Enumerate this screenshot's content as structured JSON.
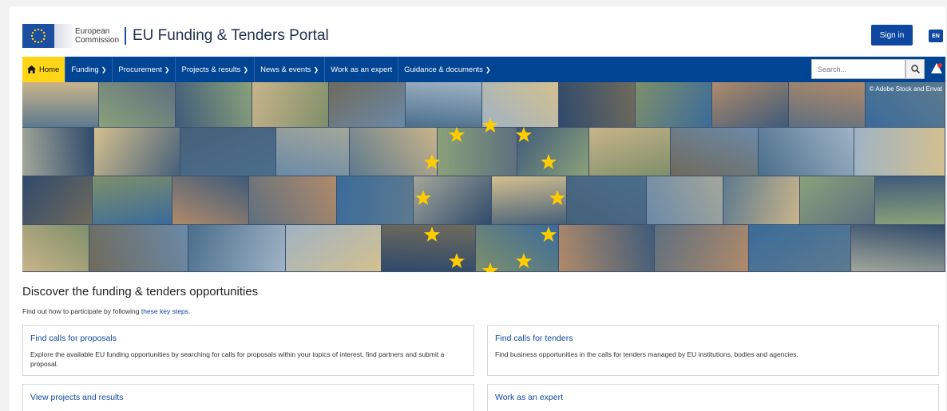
{
  "header": {
    "org_line1": "European",
    "org_line2": "Commission",
    "portal_title": "EU Funding & Tenders Portal",
    "signin_label": "Sign in",
    "lang_label": "EN"
  },
  "nav": {
    "items": [
      {
        "label": "Home",
        "icon": "home-icon",
        "active": true
      },
      {
        "label": "Funding",
        "dropdown": true
      },
      {
        "label": "Procurement",
        "dropdown": true
      },
      {
        "label": "Projects & results",
        "dropdown": true
      },
      {
        "label": "News & events",
        "dropdown": true
      },
      {
        "label": "Work as an expert",
        "dropdown": false
      },
      {
        "label": "Guidance & documents",
        "dropdown": true
      }
    ],
    "search_placeholder": "Search..."
  },
  "banner": {
    "credit": "© Adobe Stock and Envat"
  },
  "main": {
    "title": "Discover the funding & tenders opportunities",
    "subtitle_prefix": "Find out how to participate by following",
    "subtitle_link": "these key steps.",
    "cards": [
      {
        "title": "Find calls for proposals",
        "text": "Explore the available EU funding opportunities by searching for calls for proposals within your topics of interest, find partners and submit a proposal."
      },
      {
        "title": "Find calls for tenders",
        "text": "Find business opportunities in the calls for tenders managed by EU institutions, bodies and agencies."
      },
      {
        "title": "View projects and results",
        "text": ""
      },
      {
        "title": "Work as an expert",
        "text": ""
      }
    ]
  },
  "colors": {
    "brand_blue": "#004494",
    "home_yellow": "#ffd617",
    "link_blue": "#0e47a0",
    "star_yellow": "#ffcc00"
  }
}
